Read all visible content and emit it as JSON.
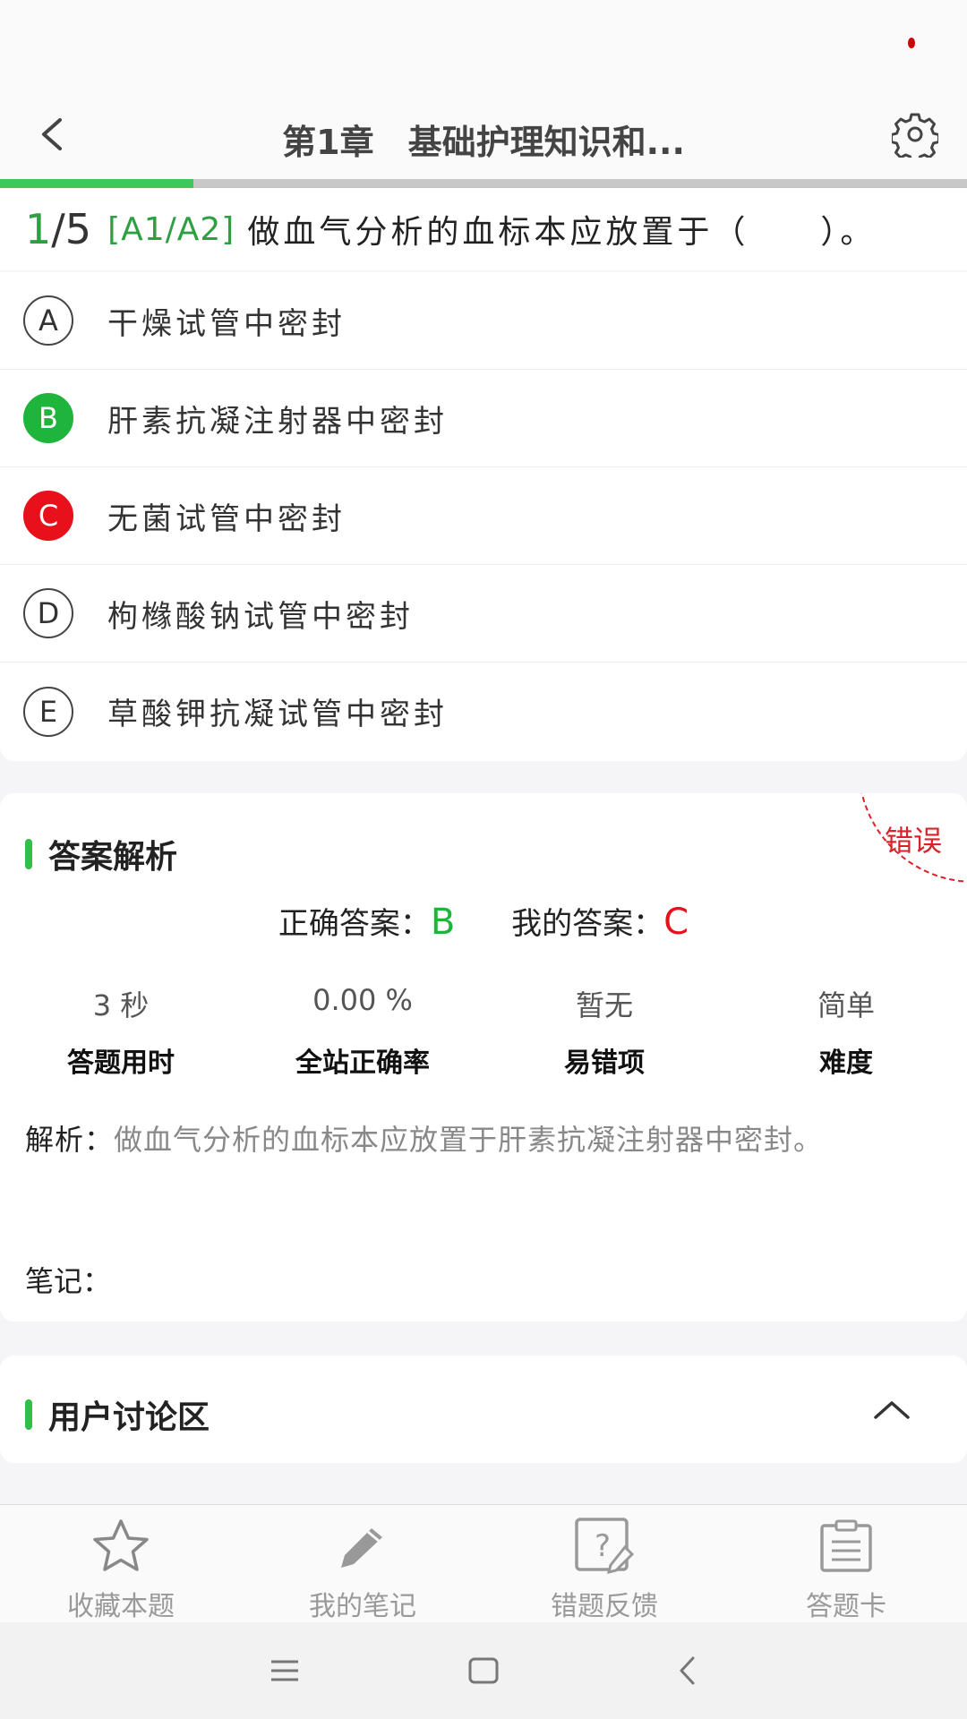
{
  "header": {
    "title": "第1章　基础护理知识和..."
  },
  "progress": {
    "current": 1,
    "total": 5,
    "fraction": 0.2
  },
  "question": {
    "number": "1",
    "separator": "/",
    "total": "5",
    "type": "[A1/A2]",
    "text": "做血气分析的血标本应放置于（　　）。"
  },
  "options": [
    {
      "letter": "A",
      "text": "干燥试管中密封",
      "state": "normal"
    },
    {
      "letter": "B",
      "text": "肝素抗凝注射器中密封",
      "state": "correct"
    },
    {
      "letter": "C",
      "text": "无菌试管中密封",
      "state": "wrong"
    },
    {
      "letter": "D",
      "text": "枸橼酸钠试管中密封",
      "state": "normal"
    },
    {
      "letter": "E",
      "text": "草酸钾抗凝试管中密封",
      "state": "normal"
    }
  ],
  "analysis": {
    "title": "答案解析",
    "stamp": "错误",
    "correct_label": "正确答案：",
    "correct_value": "B",
    "mine_label": "我的答案：",
    "mine_value": "C",
    "stats": [
      {
        "value": "3 秒",
        "label": "答题用时"
      },
      {
        "value": "0.00 %",
        "label": "全站正确率"
      },
      {
        "value": "暂无",
        "label": "易错项"
      },
      {
        "value": "简单",
        "label": "难度"
      }
    ],
    "explain_label": "解析：",
    "explain_text": "做血气分析的血标本应放置于肝素抗凝注射器中密封。",
    "note_label": "笔记："
  },
  "discussion": {
    "title": "用户讨论区"
  },
  "tabbar": [
    {
      "label": "收藏本题",
      "icon": "star-icon"
    },
    {
      "label": "我的笔记",
      "icon": "pencil-icon"
    },
    {
      "label": "错题反馈",
      "icon": "feedback-icon"
    },
    {
      "label": "答题卡",
      "icon": "clipboard-icon"
    }
  ],
  "colors": {
    "accent": "#2ec04a",
    "correct": "#1fb53c",
    "wrong": "#e8101a"
  }
}
